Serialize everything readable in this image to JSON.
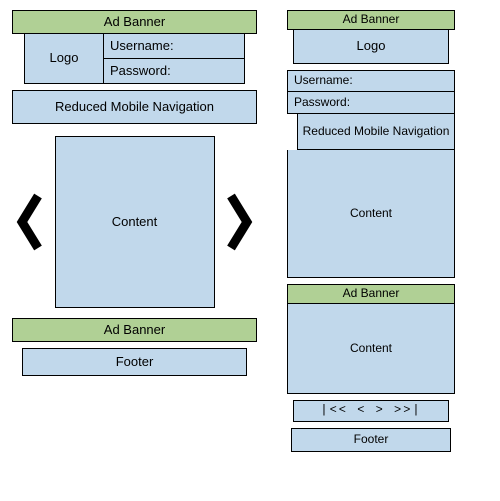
{
  "left": {
    "ad_top": "Ad Banner",
    "logo": "Logo",
    "username_label": "Username:",
    "password_label": "Password:",
    "nav": "Reduced Mobile Navigation",
    "content": "Content",
    "ad_bottom": "Ad Banner",
    "footer": "Footer"
  },
  "right": {
    "ad_top": "Ad Banner",
    "logo": "Logo",
    "username_label": "Username:",
    "password_label": "Password:",
    "nav": "Reduced Mobile\nNavigation",
    "content1": "Content",
    "ad_mid": "Ad Banner",
    "content2": "Content",
    "pager": "|<<   <           >   >>|",
    "footer": "Footer"
  }
}
